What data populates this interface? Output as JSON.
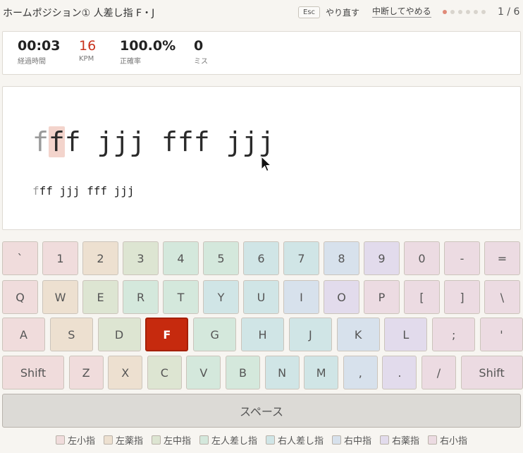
{
  "header": {
    "title": "ホームポジション① 人差し指 F・J",
    "esc_label": "Esc",
    "redo_label": "やり直す",
    "quit_label": "中断してやめる",
    "progress_current": 1,
    "progress_total": 6,
    "pager_text": "1 / 6"
  },
  "stats": {
    "time": {
      "value": "00:03",
      "label": "経過時間"
    },
    "kpm": {
      "value": "16",
      "label": "KPM"
    },
    "accuracy": {
      "value": "100.0%",
      "label": "正確率"
    },
    "misses": {
      "value": "0",
      "label": "ミス"
    }
  },
  "practice": {
    "big_typed": "f",
    "big_cursor": "f",
    "big_rest": "f jjj fff jjj",
    "small_typed": "f",
    "small_rest": "ff jjj fff jjj"
  },
  "keyboard": {
    "active_key": "F",
    "rows": [
      [
        {
          "label": "`",
          "finger": "lp"
        },
        {
          "label": "1",
          "finger": "lp"
        },
        {
          "label": "2",
          "finger": "lr"
        },
        {
          "label": "3",
          "finger": "lm"
        },
        {
          "label": "4",
          "finger": "li"
        },
        {
          "label": "5",
          "finger": "li"
        },
        {
          "label": "6",
          "finger": "ri"
        },
        {
          "label": "7",
          "finger": "ri"
        },
        {
          "label": "8",
          "finger": "rm"
        },
        {
          "label": "9",
          "finger": "rr"
        },
        {
          "label": "0",
          "finger": "rp"
        },
        {
          "label": "-",
          "finger": "rp"
        },
        {
          "label": "=",
          "finger": "rp"
        }
      ],
      [
        {
          "label": "Q",
          "finger": "lp"
        },
        {
          "label": "W",
          "finger": "lr"
        },
        {
          "label": "E",
          "finger": "lm"
        },
        {
          "label": "R",
          "finger": "li"
        },
        {
          "label": "T",
          "finger": "li"
        },
        {
          "label": "Y",
          "finger": "ri"
        },
        {
          "label": "U",
          "finger": "ri"
        },
        {
          "label": "I",
          "finger": "rm"
        },
        {
          "label": "O",
          "finger": "rr"
        },
        {
          "label": "P",
          "finger": "rp"
        },
        {
          "label": "[",
          "finger": "rp"
        },
        {
          "label": "]",
          "finger": "rp"
        },
        {
          "label": "\\",
          "finger": "rp"
        }
      ],
      [
        {
          "label": "A",
          "finger": "lp"
        },
        {
          "label": "S",
          "finger": "lr"
        },
        {
          "label": "D",
          "finger": "lm"
        },
        {
          "label": "F",
          "finger": "li"
        },
        {
          "label": "G",
          "finger": "li"
        },
        {
          "label": "H",
          "finger": "ri"
        },
        {
          "label": "J",
          "finger": "ri"
        },
        {
          "label": "K",
          "finger": "rm"
        },
        {
          "label": "L",
          "finger": "rr"
        },
        {
          "label": ";",
          "finger": "rp"
        },
        {
          "label": "'",
          "finger": "rp"
        }
      ],
      [
        {
          "label": "Shift",
          "finger": "lp"
        },
        {
          "label": "Z",
          "finger": "lp"
        },
        {
          "label": "X",
          "finger": "lr"
        },
        {
          "label": "C",
          "finger": "lm"
        },
        {
          "label": "V",
          "finger": "li"
        },
        {
          "label": "B",
          "finger": "li"
        },
        {
          "label": "N",
          "finger": "ri"
        },
        {
          "label": "M",
          "finger": "ri"
        },
        {
          "label": ",",
          "finger": "rm"
        },
        {
          "label": ".",
          "finger": "rr"
        },
        {
          "label": "/",
          "finger": "rp"
        },
        {
          "label": "Shift",
          "finger": "rp"
        }
      ],
      [
        {
          "label": "スペース",
          "finger": "th"
        }
      ]
    ]
  },
  "legend": [
    {
      "label": "左小指",
      "finger": "lp"
    },
    {
      "label": "左薬指",
      "finger": "lr"
    },
    {
      "label": "左中指",
      "finger": "lm"
    },
    {
      "label": "左人差し指",
      "finger": "li"
    },
    {
      "label": "右人差し指",
      "finger": "ri"
    },
    {
      "label": "右中指",
      "finger": "rm"
    },
    {
      "label": "右薬指",
      "finger": "rr"
    },
    {
      "label": "右小指",
      "finger": "rp"
    }
  ],
  "colors": {
    "accent": "#c62a0e",
    "kpm": "#c8321c",
    "progress_dot_active": "#e08a78"
  }
}
